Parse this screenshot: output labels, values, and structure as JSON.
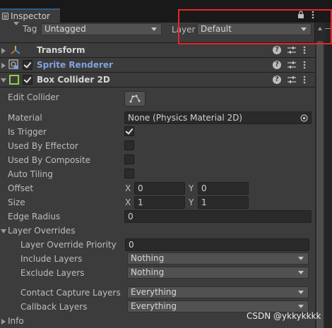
{
  "tab": {
    "label": "Inspector"
  },
  "header": {
    "tag_label": "Tag",
    "tag_value": "Untagged",
    "layer_label": "Layer",
    "layer_value": "Default"
  },
  "components": {
    "transform": {
      "title": "Transform"
    },
    "sprite_renderer": {
      "title": "Sprite Renderer",
      "color": "#7fa3e0"
    },
    "box_collider": {
      "title": "Box Collider 2D"
    }
  },
  "fields": {
    "edit_collider": "Edit Collider",
    "material_label": "Material",
    "material_value": "None (Physics Material 2D)",
    "is_trigger": "Is Trigger",
    "used_by_effector": "Used By Effector",
    "used_by_composite": "Used By Composite",
    "auto_tiling": "Auto Tiling",
    "offset_label": "Offset",
    "offset_x": "0",
    "offset_y": "0",
    "size_label": "Size",
    "size_x": "1",
    "size_y": "1",
    "edge_radius_label": "Edge Radius",
    "edge_radius_value": "0",
    "x_label": "X",
    "y_label": "Y"
  },
  "layer_overrides": {
    "title": "Layer Overrides",
    "priority_label": "Layer Override Priority",
    "priority_value": "0",
    "include_label": "Include Layers",
    "include_value": "Nothing",
    "exclude_label": "Exclude Layers",
    "exclude_value": "Nothing",
    "contact_label": "Contact Capture Layers",
    "contact_value": "Everything",
    "callback_label": "Callback Layers",
    "callback_value": "Everything"
  },
  "info": {
    "title": "Info"
  },
  "watermark": "CSDN @ykkykkkk"
}
